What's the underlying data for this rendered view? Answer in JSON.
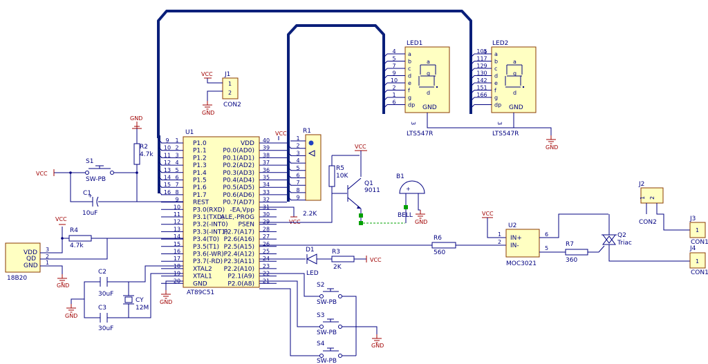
{
  "power": {
    "vcc": "VCC",
    "gnd": "GND"
  },
  "u1": {
    "ref": "U1",
    "value": "AT89C51",
    "left_pins": [
      {
        "num": "1",
        "name": "P1.0"
      },
      {
        "num": "2",
        "name": "P1.1"
      },
      {
        "num": "3",
        "name": "P1.2"
      },
      {
        "num": "4",
        "name": "P1.3"
      },
      {
        "num": "5",
        "name": "P1.4"
      },
      {
        "num": "6",
        "name": "P1.5"
      },
      {
        "num": "7",
        "name": "P1.6"
      },
      {
        "num": "8",
        "name": "P1.7"
      },
      {
        "num": "9",
        "name": "REST"
      },
      {
        "num": "10",
        "name": "P3.0(RXD)"
      },
      {
        "num": "11",
        "name": "P3.1(TXD)"
      },
      {
        "num": "12",
        "name": "P3.2(-INT0)"
      },
      {
        "num": "13",
        "name": "P3.3(-INT1)"
      },
      {
        "num": "14",
        "name": "P3.4(T0)"
      },
      {
        "num": "15",
        "name": "P3.5(T1)"
      },
      {
        "num": "16",
        "name": "P3.6(-WR)"
      },
      {
        "num": "17",
        "name": "P3.7(-RD)"
      },
      {
        "num": "18",
        "name": "XTAL2"
      },
      {
        "num": "19",
        "name": "XTAL1"
      },
      {
        "num": "20",
        "name": "GND"
      }
    ],
    "right_pins": [
      {
        "num": "40",
        "name": "VDD"
      },
      {
        "num": "39",
        "name": "P0.0(AD0)"
      },
      {
        "num": "38",
        "name": "P0.1(AD1)"
      },
      {
        "num": "37",
        "name": "P0.2(AD2)"
      },
      {
        "num": "36",
        "name": "P0.3(AD3)"
      },
      {
        "num": "35",
        "name": "P0.4(AD4)"
      },
      {
        "num": "34",
        "name": "P0.5(AD5)"
      },
      {
        "num": "33",
        "name": "P0.6(AD6)"
      },
      {
        "num": "32",
        "name": "P0.7(AD7)"
      },
      {
        "num": "31",
        "name": "-EA,Vpp"
      },
      {
        "num": "30",
        "name": "ALE,-PROG"
      },
      {
        "num": "29",
        "name": "PSEN"
      },
      {
        "num": "28",
        "name": "P2.7(A17)"
      },
      {
        "num": "27",
        "name": "P2.6(A16)"
      },
      {
        "num": "26",
        "name": "P2.5(A15)"
      },
      {
        "num": "25",
        "name": "P2.4(A12)"
      },
      {
        "num": "24",
        "name": "P2.3(A11)"
      },
      {
        "num": "23",
        "name": "P2.2(A10)"
      },
      {
        "num": "22",
        "name": "P2.1(A9)"
      },
      {
        "num": "21",
        "name": "P2.0(A8)"
      }
    ],
    "bus_numbers": [
      "9",
      "10",
      "11",
      "12",
      "13",
      "14",
      "15",
      "16"
    ]
  },
  "r1": {
    "ref": "R1",
    "value": "2.2K",
    "pins": [
      "1",
      "2",
      "3",
      "4",
      "5",
      "6",
      "7",
      "8",
      "9"
    ]
  },
  "led1": {
    "ref": "LED1",
    "value": "LTS547R",
    "segs": [
      "a",
      "b",
      "c",
      "d",
      "e",
      "f",
      "g",
      "dp"
    ],
    "nums": [
      "4",
      "5",
      "7",
      "9",
      "10",
      "2",
      "1",
      "6"
    ],
    "gnd": "GND",
    "com": "3",
    "digit_a": "a",
    "digit_g": "g",
    "digit_d": "d"
  },
  "led2": {
    "ref": "LED2",
    "value": "LTS547R",
    "segs": [
      "a",
      "b",
      "c",
      "d",
      "e",
      "f",
      "g",
      "dp"
    ],
    "nums": [
      "105",
      "117",
      "129",
      "130",
      "142",
      "151",
      "166",
      ""
    ],
    "net_top": "4",
    "gnd": "GND",
    "com": "3",
    "digit_a": "a",
    "digit_g": "g",
    "digit_d": "d"
  },
  "led2_bus_nums": [
    "105",
    "117",
    "129",
    "130",
    "142",
    "151",
    "166"
  ],
  "j1": {
    "ref": "J1",
    "value": "CON2",
    "pins": [
      "1",
      "2"
    ]
  },
  "j2": {
    "ref": "J2",
    "value": "CON2",
    "pins": [
      "1",
      "2"
    ]
  },
  "j3": {
    "ref": "J3",
    "value": "CON1",
    "pin": "1"
  },
  "j4": {
    "ref": "J4",
    "value": "CON1",
    "pin": "1"
  },
  "u2": {
    "ref": "U2",
    "value": "MOC3021",
    "pins": [
      {
        "num": "1",
        "name": "IN+"
      },
      {
        "num": "2",
        "name": "IN-"
      }
    ],
    "rpins": [
      "6",
      "5"
    ]
  },
  "r2": {
    "ref": "R2",
    "value": "4.7k"
  },
  "r3": {
    "ref": "R3",
    "value": "2K"
  },
  "r4": {
    "ref": "R4",
    "value": "4.7k"
  },
  "r5": {
    "ref": "R5",
    "value": "10K"
  },
  "r6": {
    "ref": "R6",
    "value": "560"
  },
  "r7": {
    "ref": "R7",
    "value": "360"
  },
  "c1": {
    "ref": "C1",
    "value": "10uF"
  },
  "c2": {
    "ref": "C2",
    "value": "30uF"
  },
  "c3": {
    "ref": "C3",
    "value": "30uF"
  },
  "cy": {
    "ref": "CY",
    "value": "12M"
  },
  "s1": {
    "ref": "S1",
    "value": "SW-PB"
  },
  "s2": {
    "ref": "S2",
    "value": "SW-PB"
  },
  "s3": {
    "ref": "S3",
    "value": "SW-PB"
  },
  "s4": {
    "ref": "S4",
    "value": "SW-PB"
  },
  "q1": {
    "ref": "Q1",
    "value": "9011"
  },
  "q2": {
    "ref": "Q2",
    "value": "Triac"
  },
  "b1": {
    "ref": "B1",
    "value": "BELL"
  },
  "d1": {
    "ref": "D1",
    "value": "LED"
  },
  "ds18b20": {
    "value": "18B20",
    "pins": [
      {
        "name": "VDD",
        "num": "3"
      },
      {
        "name": "QD",
        "num": "2"
      },
      {
        "name": "GND",
        "num": "1"
      }
    ]
  },
  "colors": {
    "wire": "#000080",
    "bus": "#0a1f7a",
    "part_fill": "#ffffc2",
    "part_border": "#8a3a00",
    "power": "#a00000",
    "junction_green": "#00a000"
  }
}
